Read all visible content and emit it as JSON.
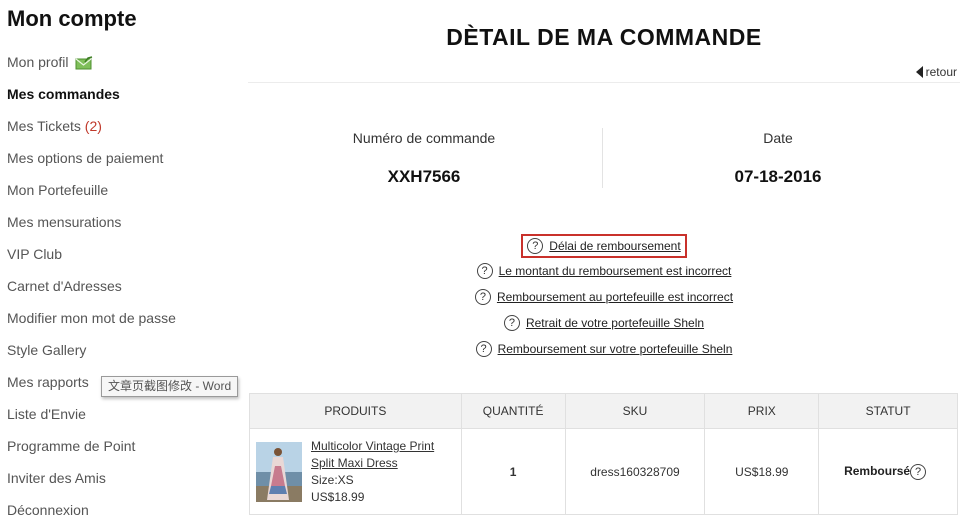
{
  "sidebar": {
    "title": "Mon compte",
    "items": [
      {
        "label": "Mon profil"
      },
      {
        "label": "Mes commandes"
      },
      {
        "label": "Mes Tickets",
        "count": "(2)"
      },
      {
        "label": "Mes options de paiement"
      },
      {
        "label": "Mon Portefeuille"
      },
      {
        "label": "Mes mensurations"
      },
      {
        "label": "VIP Club"
      },
      {
        "label": "Carnet d'Adresses"
      },
      {
        "label": "Modifier mon mot de passe"
      },
      {
        "label": "Style Gallery"
      },
      {
        "label": "Mes rapports"
      },
      {
        "label": "Liste d'Envie"
      },
      {
        "label": "Programme de Point"
      },
      {
        "label": "Inviter des Amis"
      },
      {
        "label": "Déconnexion"
      }
    ]
  },
  "tooltip": {
    "text": "文章页截图修改 - Word"
  },
  "main": {
    "title": "DÈTAIL DE MA COMMANDE",
    "back_label": "retour",
    "order_number_label": "Numéro de commande",
    "order_number": "XXH7566",
    "date_label": "Date",
    "date": "07-18-2016",
    "help_links": [
      {
        "label": "Délai de remboursement"
      },
      {
        "label": "Le montant du remboursement est incorrect"
      },
      {
        "label": "Remboursement au portefeuille est incorrect"
      },
      {
        "label": "Retrait de votre portefeuille Sheln"
      },
      {
        "label": "Remboursement sur votre portefeuille Sheln"
      }
    ]
  },
  "table": {
    "headers": [
      "PRODUITS",
      "QUANTITÉ",
      "SKU",
      "PRIX",
      "STATUT"
    ],
    "rows": [
      {
        "name_line1": "Multicolor Vintage Print",
        "name_line2": "Split Maxi Dress",
        "size": "Size:XS",
        "unit_price": "US$18.99",
        "quantity": "1",
        "sku": "dress160328709",
        "price": "US$18.99",
        "status": "Remboursé"
      }
    ]
  },
  "colors": {
    "highlight": "#c9312b",
    "ticket_count": "#c0392b",
    "header_bg": "#f2f2f2"
  }
}
